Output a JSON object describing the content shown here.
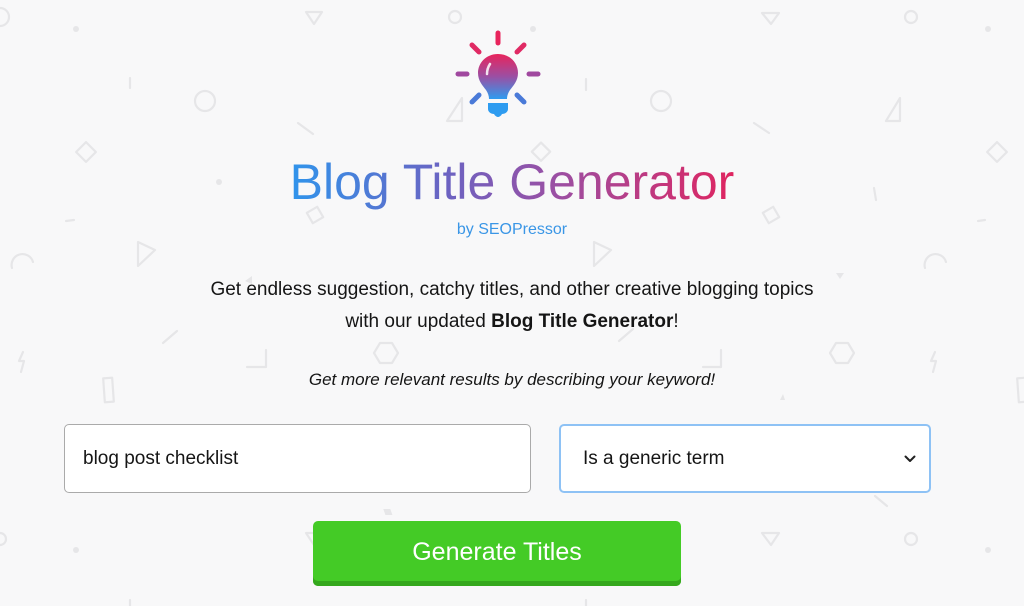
{
  "header": {
    "logo_icon": "lightbulb-icon",
    "title": "Blog Title Generator",
    "byline": "by SEOPressor"
  },
  "intro": {
    "line1": "Get endless suggestion, catchy titles, and other creative blogging topics",
    "line2_prefix": "with our updated ",
    "line2_bold": "Blog Title Generator",
    "line2_suffix": "!",
    "hint": "Get more relevant results by describing your keyword!"
  },
  "form": {
    "keyword_value": "blog post checklist",
    "keyword_type_selected": "Is a generic term",
    "select_icon": "chevron-down-icon",
    "submit_label": "Generate Titles"
  },
  "colors": {
    "title_gradient_start": "#2f95ec",
    "title_gradient_end": "#e0245f",
    "byline": "#3a96e6",
    "button": "#44cb26",
    "select_focus_border": "#8ec2f5",
    "background": "#f8f8f9"
  }
}
